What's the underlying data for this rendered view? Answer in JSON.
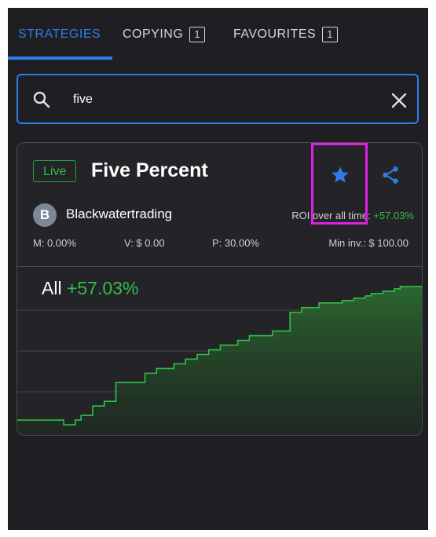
{
  "tabs": [
    {
      "label": "STRATEGIES",
      "count": ""
    },
    {
      "label": "COPYING",
      "count": "1"
    },
    {
      "label": "FAVOURITES",
      "count": "1"
    }
  ],
  "search": {
    "value": "five"
  },
  "strategy": {
    "status": "Live",
    "name": "Five Percent",
    "trader_initial": "B",
    "trader_name": "Blackwatertrading",
    "roi_label": "ROI over all time:",
    "roi_value": "+57.03%",
    "stats": {
      "m": "M: 0.00%",
      "v": "V: $ 0.00",
      "p": "P: 30.00%",
      "min_inv": "Min inv.: $ 100.00"
    },
    "chart_period": "All",
    "chart_value": "+57.03%"
  },
  "colors": {
    "accent": "#2d7de6",
    "positive": "#2fbf47",
    "highlight": "#e020e8",
    "background": "#1f1f23"
  },
  "chart_data": {
    "type": "area",
    "x": [
      0,
      1,
      2,
      3,
      4,
      5,
      6,
      7,
      8,
      9,
      10,
      11,
      12,
      13,
      14,
      15,
      16,
      17,
      18,
      19,
      20,
      21,
      22,
      23,
      24,
      25,
      26,
      27,
      28,
      29,
      30,
      31,
      32,
      33,
      34,
      35,
      36,
      37,
      38,
      39,
      40,
      41,
      42,
      43,
      44,
      45,
      46,
      47,
      48,
      49,
      50,
      51,
      52,
      53,
      54,
      55,
      56,
      57,
      58,
      59,
      60,
      61,
      62,
      63,
      64,
      65,
      66,
      67,
      68,
      69,
      70
    ],
    "values": [
      0,
      0,
      0,
      0,
      0,
      0,
      0,
      0,
      -2,
      -2,
      0,
      2,
      2,
      6,
      6,
      8,
      8,
      16,
      16,
      16,
      16,
      16,
      20,
      20,
      22,
      22,
      22,
      24,
      24,
      26,
      26,
      28,
      28,
      30,
      30,
      32,
      32,
      32,
      34,
      34,
      36,
      36,
      36,
      36,
      38,
      38,
      38,
      46,
      46,
      48,
      48,
      48,
      50,
      50,
      50,
      50,
      51,
      51,
      52,
      52,
      53,
      54,
      54,
      55,
      55,
      56,
      57,
      57,
      57,
      57,
      57.03
    ],
    "ylim": [
      -5,
      62
    ],
    "grid": true
  }
}
